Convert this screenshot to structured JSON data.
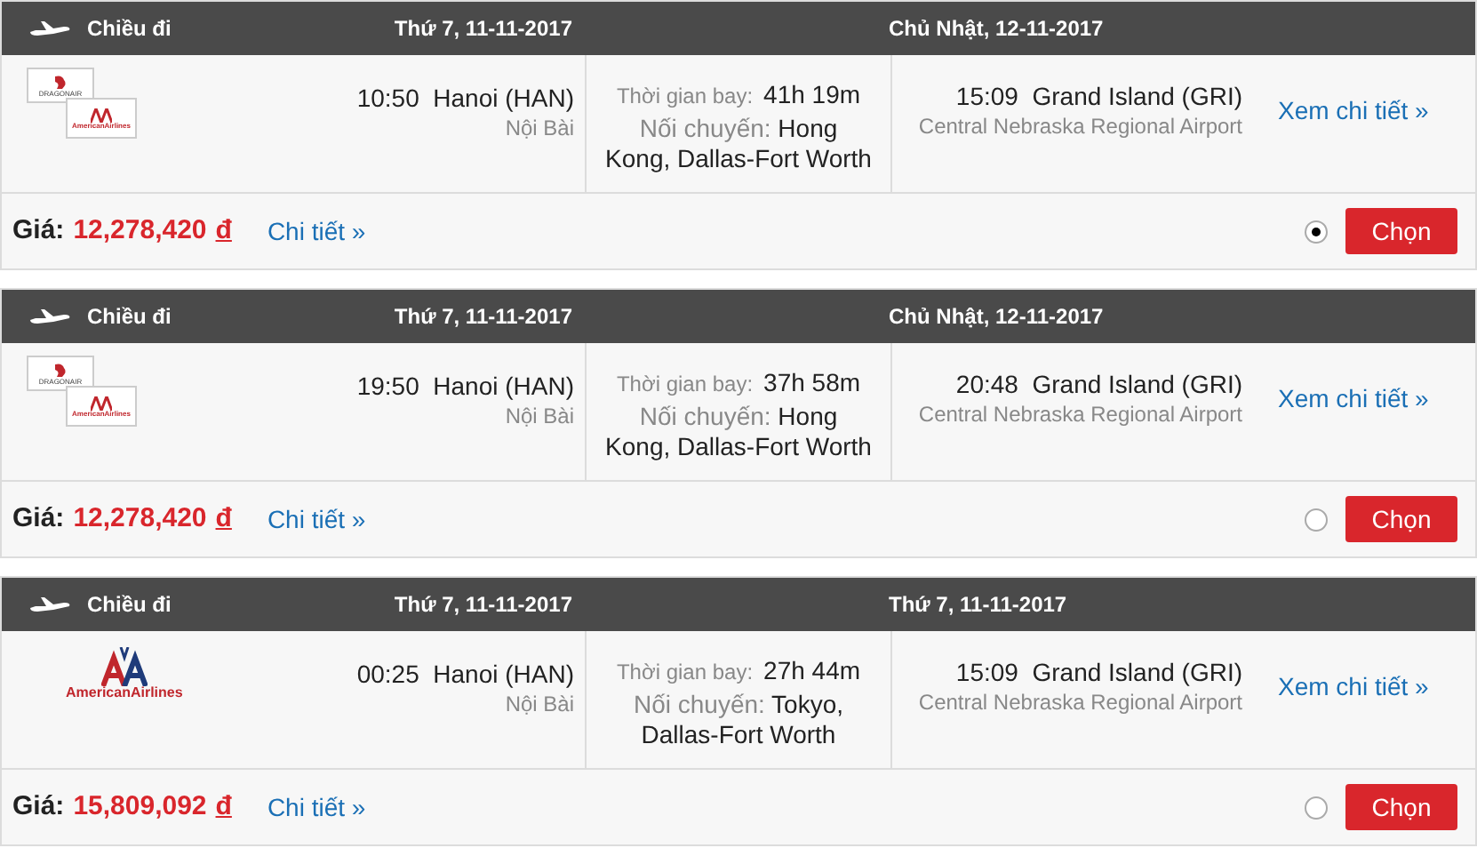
{
  "flights": [
    {
      "direction": "Chiều đi",
      "depart_date": "Thứ 7, 11-11-2017",
      "arrive_date": "Chủ Nhật, 12-11-2017",
      "logos": [
        {
          "kind": "dragonair",
          "text": "DRAGONAIR"
        },
        {
          "kind": "american",
          "text": "AmericanAirlines"
        }
      ],
      "depart_time": "10:50",
      "depart_city": "Hanoi (HAN)",
      "depart_airport": "Nội Bài",
      "duration_label": "Thời gian bay:",
      "duration": "41h 19m",
      "stops_label": "Nối chuyến:",
      "stops": "Hong Kong, Dallas-Fort Worth",
      "arrive_time": "15:09",
      "arrive_city": "Grand Island (GRI)",
      "arrive_airport": "Central Nebraska Regional Airport",
      "details_link": "Xem chi tiết »",
      "price_label": "Giá:",
      "price": "12,278,420",
      "currency": "đ",
      "more_link": "Chi tiết »",
      "selected": true,
      "button": "Chọn"
    },
    {
      "direction": "Chiều đi",
      "depart_date": "Thứ 7, 11-11-2017",
      "arrive_date": "Chủ Nhật, 12-11-2017",
      "logos": [
        {
          "kind": "dragonair",
          "text": "DRAGONAIR"
        },
        {
          "kind": "american",
          "text": "AmericanAirlines"
        }
      ],
      "depart_time": "19:50",
      "depart_city": "Hanoi (HAN)",
      "depart_airport": "Nội Bài",
      "duration_label": "Thời gian bay:",
      "duration": "37h 58m",
      "stops_label": "Nối chuyến:",
      "stops": "Hong Kong, Dallas-Fort Worth",
      "arrive_time": "20:48",
      "arrive_city": "Grand Island (GRI)",
      "arrive_airport": "Central Nebraska Regional Airport",
      "details_link": "Xem chi tiết »",
      "price_label": "Giá:",
      "price": "12,278,420",
      "currency": "đ",
      "more_link": "Chi tiết »",
      "selected": false,
      "button": "Chọn"
    },
    {
      "direction": "Chiều đi",
      "depart_date": "Thứ 7, 11-11-2017",
      "arrive_date": "Thứ 7, 11-11-2017",
      "logos": [
        {
          "kind": "american_large",
          "text": "AmericanAirlines"
        }
      ],
      "depart_time": "00:25",
      "depart_city": "Hanoi (HAN)",
      "depart_airport": "Nội Bài",
      "duration_label": "Thời gian bay:",
      "duration": "27h 44m",
      "stops_label": "Nối chuyến:",
      "stops": "Tokyo, Dallas-Fort Worth",
      "arrive_time": "15:09",
      "arrive_city": "Grand Island (GRI)",
      "arrive_airport": "Central Nebraska Regional Airport",
      "details_link": "Xem chi tiết »",
      "price_label": "Giá:",
      "price": "15,809,092",
      "currency": "đ",
      "more_link": "Chi tiết »",
      "selected": false,
      "button": "Chọn"
    }
  ]
}
